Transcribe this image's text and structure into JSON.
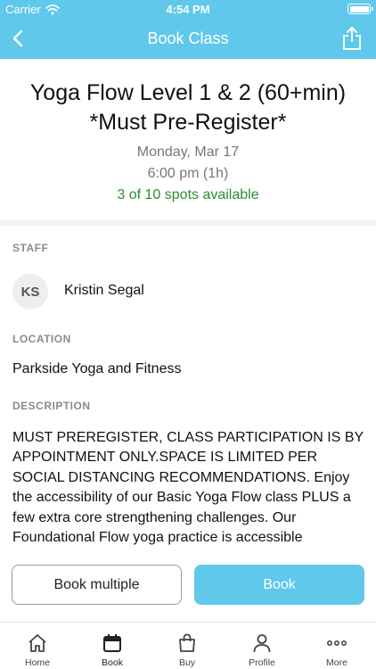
{
  "status_bar": {
    "carrier": "Carrier",
    "time": "4:54 PM"
  },
  "nav": {
    "title": "Book Class"
  },
  "class_info": {
    "title": "Yoga Flow Level 1 & 2 (60+min) *Must Pre-Register*",
    "date": "Monday, Mar 17",
    "time": "6:00 pm (1h)",
    "spots": "3 of 10 spots available"
  },
  "staff": {
    "label": "STAFF",
    "initials": "KS",
    "name": "Kristin Segal"
  },
  "location": {
    "label": "LOCATION",
    "value": "Parkside Yoga and Fitness"
  },
  "description": {
    "label": "DESCRIPTION",
    "text": "MUST PREREGISTER, CLASS PARTICIPATION IS BY APPOINTMENT ONLY.SPACE IS LIMITED PER SOCIAL DISTANCING RECOMMENDATIONS. Enjoy the accessibility of our Basic Yoga Flow class PLUS a few extra core strengthening challenges. Our Foundational Flow yoga practice is accessible"
  },
  "actions": {
    "book_multiple": "Book multiple",
    "book": "Book"
  },
  "tabs": [
    {
      "label": "Home",
      "icon": "home-icon"
    },
    {
      "label": "Book",
      "icon": "calendar-icon"
    },
    {
      "label": "Buy",
      "icon": "shopping-bag-icon"
    },
    {
      "label": "Profile",
      "icon": "person-icon"
    },
    {
      "label": "More",
      "icon": "more-dots-icon"
    }
  ],
  "colors": {
    "accent": "#5fc8eb",
    "spots_available": "#2e8b2e"
  }
}
